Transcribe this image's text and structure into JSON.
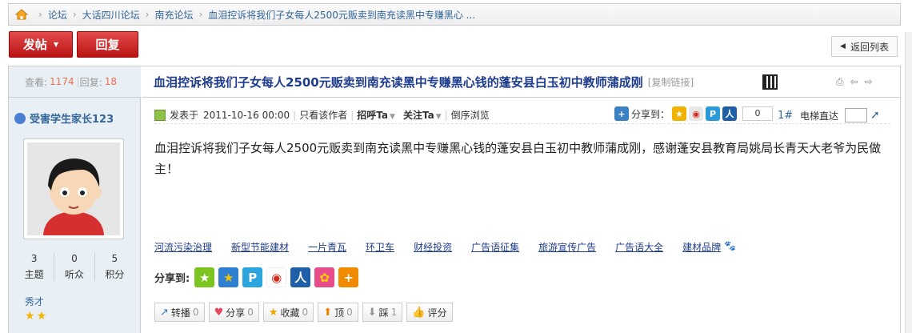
{
  "breadcrumb": {
    "items": [
      "论坛",
      "大话四川论坛",
      "南充论坛",
      "血泪控诉将我们子女每人2500元贩卖到南充读黑中专赚黑心 ..."
    ]
  },
  "toolbar": {
    "post_label": "发帖",
    "reply_label": "回复",
    "back_label": "返回列表"
  },
  "thread": {
    "views_label": "查看:",
    "views": "1174",
    "replies_label": "回复:",
    "replies": "18",
    "title": "血泪控诉将我们子女每人2500元贩卖到南充读黑中专赚黑心钱的蓬安县白玉初中教师蒲成刚",
    "copy_link": "[复制链接]"
  },
  "author": {
    "name": "受害学生家长123",
    "stats": [
      {
        "value": "3",
        "label": "主题"
      },
      {
        "value": "0",
        "label": "听众"
      },
      {
        "value": "5",
        "label": "积分"
      }
    ],
    "rank": "秀才"
  },
  "post": {
    "posted_prefix": "发表于",
    "posted_at": "2011-10-16 00:00",
    "only_author": "只看该作者",
    "greet": "招呼Ta",
    "follow": "关注Ta",
    "reverse": "倒序浏览",
    "share_to": "分享到：",
    "share_count": "0",
    "floor": "1#",
    "elevator": "电梯直达",
    "body": "血泪控诉将我们子女每人2500元贩卖到南充读黑中专赚黑心钱的蓬安县白玉初中教师蒲成刚，感谢蓬安县教育局姚局长青天大老爷为民做主！"
  },
  "tag_links": [
    "河流污染治理",
    "新型节能建材",
    "一片青瓦",
    "环卫车",
    "财经投资",
    "广告语征集",
    "旅游宣传广告",
    "广告语大全",
    "建材品牌"
  ],
  "share_bottom_label": "分享到:",
  "actions": [
    {
      "label": "转播",
      "count": "0",
      "icon": "repost-icon"
    },
    {
      "label": "分享",
      "count": "0",
      "icon": "heart-icon"
    },
    {
      "label": "收藏",
      "count": "0",
      "icon": "star-icon"
    },
    {
      "label": "顶",
      "count": "0",
      "icon": "up-arrow-icon"
    },
    {
      "label": "踩",
      "count": "1",
      "icon": "down-arrow-icon"
    },
    {
      "label": "评分",
      "count": "",
      "icon": "thumb-icon"
    }
  ],
  "colors": {
    "accent_red": "#c81e1e",
    "link_blue": "#1e3c8c",
    "sidebar_bg": "#e8eff5"
  }
}
